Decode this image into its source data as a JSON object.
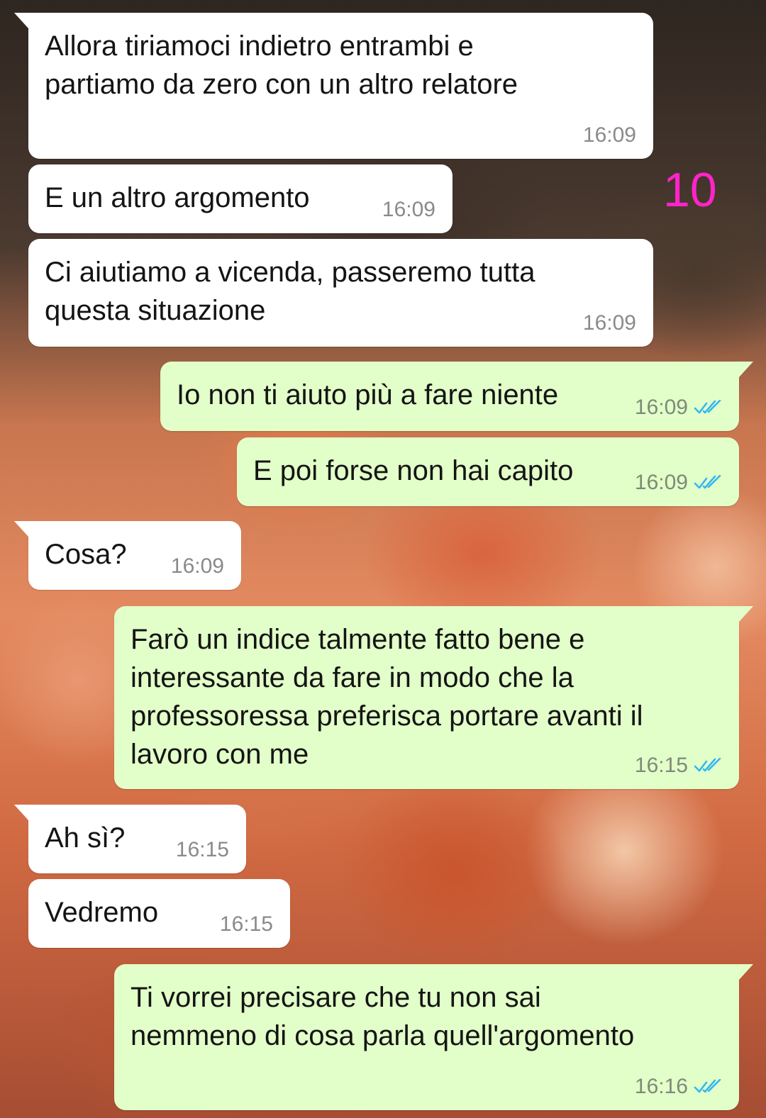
{
  "overlay_number": "10",
  "colors": {
    "incoming_bubble": "#ffffff",
    "outgoing_bubble": "#e2ffc9",
    "read_ticks": "#34b7f1",
    "overlay_number": "#ff24c8"
  },
  "messages": [
    {
      "direction": "incoming",
      "text": "Allora tiriamoci indietro entrambi e\npartiamo da zero con un altro relatore",
      "time": "16:09"
    },
    {
      "direction": "incoming",
      "text": "E un altro argomento",
      "time": "16:09"
    },
    {
      "direction": "incoming",
      "text": "Ci aiutiamo a vicenda, passeremo tutta\nquesta situazione",
      "time": "16:09"
    },
    {
      "direction": "outgoing",
      "text": "Io non ti aiuto più a fare niente",
      "time": "16:09",
      "status_icon": "double-check-read-icon"
    },
    {
      "direction": "outgoing",
      "text": "E poi forse non hai capito",
      "time": "16:09",
      "status_icon": "double-check-read-icon"
    },
    {
      "direction": "incoming",
      "text": "Cosa?",
      "time": "16:09"
    },
    {
      "direction": "outgoing",
      "text": "Farò un indice talmente fatto bene e\ninteressante da fare in modo che la\nprofessoressa preferisca portare avanti il\nlavoro con me",
      "time": "16:15",
      "status_icon": "double-check-read-icon"
    },
    {
      "direction": "incoming",
      "text": "Ah sì?",
      "time": "16:15"
    },
    {
      "direction": "incoming",
      "text": "Vedremo",
      "time": "16:15"
    },
    {
      "direction": "outgoing",
      "text": "Ti vorrei precisare che tu non sai\nnemmeno di cosa parla quell'argomento",
      "time": "16:16",
      "status_icon": "double-check-read-icon"
    }
  ]
}
